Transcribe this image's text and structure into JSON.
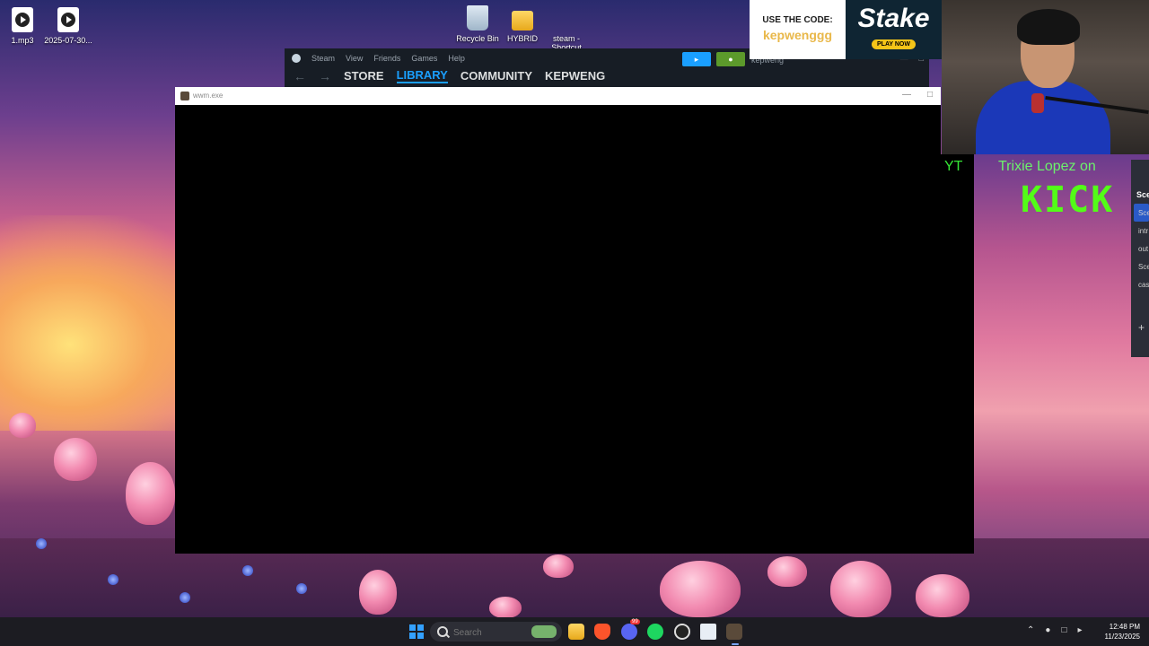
{
  "desktop": {
    "icons": [
      {
        "label": "1.mp3"
      },
      {
        "label": "2025-07-30..."
      },
      {
        "label": "Recycle Bin"
      },
      {
        "label": "HYBRID"
      },
      {
        "label": "steam - Shortcut"
      }
    ]
  },
  "steam": {
    "menu": [
      "Steam",
      "View",
      "Friends",
      "Games",
      "Help"
    ],
    "nav": [
      "STORE",
      "LIBRARY",
      "COMMUNITY",
      "KEPWENG"
    ],
    "active_nav": "LIBRARY",
    "user_text": "kepweng"
  },
  "game_window": {
    "title": "wwm.exe"
  },
  "overlay": {
    "ad_code_label": "USE THE CODE:",
    "ad_code": "kepwenggg",
    "ad_brand": "Stake",
    "ad_cta": "PLAY NOW",
    "yt": "YT",
    "kick_label": "Trixie Lopez on",
    "kick_logo": "KICK",
    "obs_header": "Sce",
    "obs_rows": [
      "Sce",
      "intr",
      "out",
      "Sce",
      "cas"
    ]
  },
  "taskbar": {
    "search_placeholder": "Search",
    "time": "12:48 PM",
    "date": "11/23/2025",
    "discord_badge": "99"
  },
  "colors": {
    "steam_accent": "#1a9fff",
    "kick_green": "#53fc18",
    "stake_yellow": "#f5c518"
  }
}
